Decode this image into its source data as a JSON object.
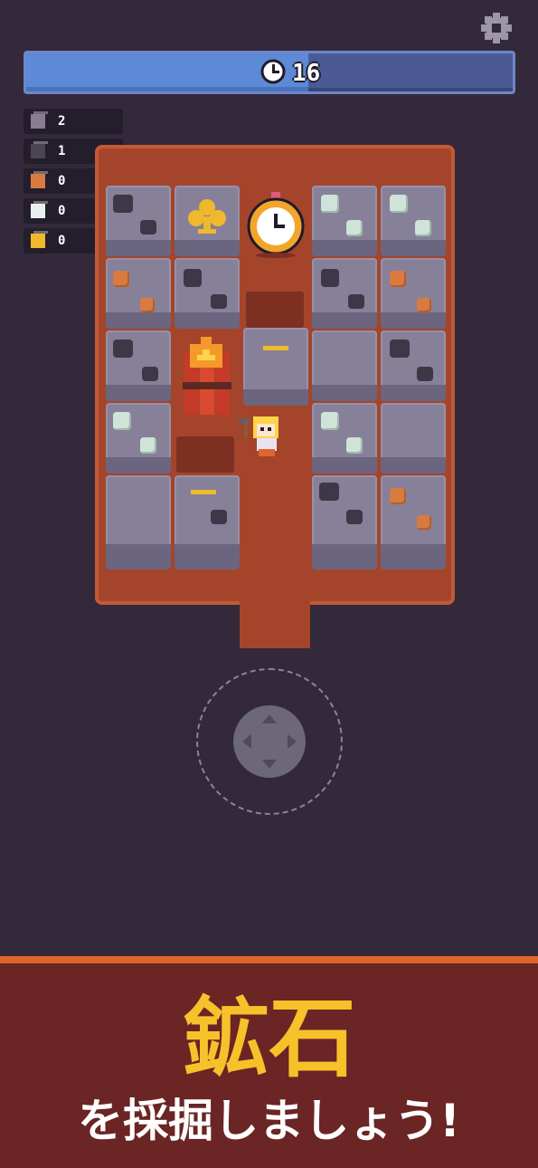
{
  "timer": {
    "seconds": "16",
    "fill_fraction": 0.58,
    "icon": "clock-icon",
    "color_fill": "#5d8ad6",
    "color_track": "#4b5a95"
  },
  "settings": {
    "icon": "gear-icon"
  },
  "inventory": [
    {
      "ore": "stone",
      "count": "2",
      "color": "#8a7c93"
    },
    {
      "ore": "coal",
      "count": "1",
      "color": "#4b4552"
    },
    {
      "ore": "copper",
      "count": "0",
      "color": "#d97b41"
    },
    {
      "ore": "silver",
      "count": "0",
      "color": "#e8f0ee"
    },
    {
      "ore": "gold",
      "count": "0",
      "color": "#f0b92b"
    }
  ],
  "banner": {
    "title": "鉱石",
    "subtitle": "を採掘しましょう!"
  },
  "colors": {
    "background": "#33293a",
    "banner": "#6a2524",
    "banner_accent": "#e0642b",
    "title": "#f7c12a"
  }
}
